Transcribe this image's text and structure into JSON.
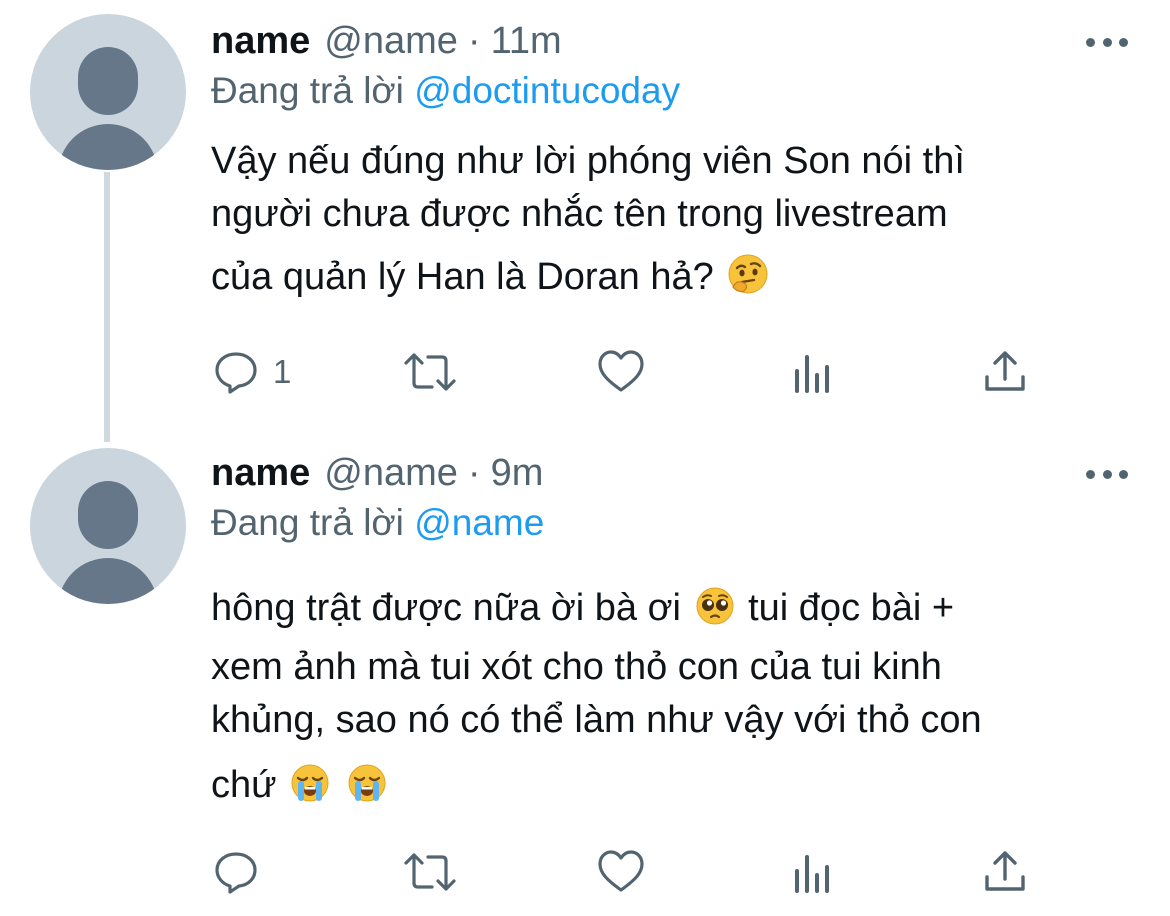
{
  "tweets": [
    {
      "display_name": "name",
      "handle": "@name",
      "separator": "·",
      "time": "11m",
      "reply_prefix": "Đang trả lời",
      "reply_mention": "@doctintucoday",
      "lines": [
        "Vậy nếu đúng như lời phóng viên Son nói thì",
        "người chưa được nhắc tên trong livestream",
        "của quản lý Han là Doran hả?"
      ],
      "emojis": [
        "thinking-face"
      ],
      "reply_count": "1"
    },
    {
      "display_name": "name",
      "handle": "@name",
      "separator": "·",
      "time": "9m",
      "reply_prefix": "Đang trả lời",
      "reply_mention": "@name",
      "lines": [
        "hông trật được nữa ời bà ơi",
        "tui đọc bài +",
        "xem ảnh mà tui xót cho thỏ con của tui kinh",
        "khủng, sao nó có thể làm như vậy với thỏ con",
        "chứ"
      ],
      "emojis": [
        "pleading-face",
        "loudly-crying-face",
        "loudly-crying-face"
      ],
      "reply_count": ""
    }
  ],
  "icons": [
    "reply-icon",
    "retweet-icon",
    "like-icon",
    "analytics-icon",
    "share-icon",
    "more-icon"
  ],
  "colors": {
    "text": "#0f1419",
    "secondary": "#536471",
    "link": "#1d9bf0",
    "avatar_bg": "#cbd5dd",
    "avatar_fg": "#67778a"
  }
}
